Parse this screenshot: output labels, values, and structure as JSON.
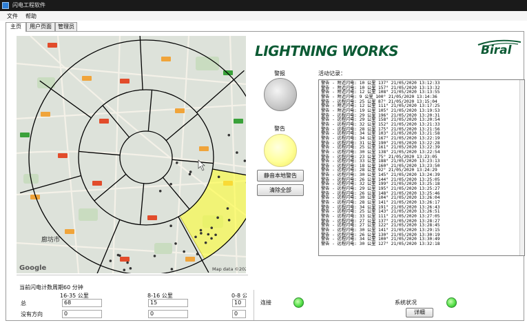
{
  "window": {
    "title": "闪电工程软件"
  },
  "menu": {
    "items": [
      "文件",
      "帮助"
    ]
  },
  "tabs": [
    {
      "label": "主页",
      "active": true
    },
    {
      "label": "用户页面",
      "active": false
    },
    {
      "label": "管理员",
      "active": false
    }
  ],
  "map": {
    "provider_logo": "Google",
    "attribution": "Map data ©2020",
    "city_label": "廊坊市",
    "highlight_color": "#ffff33",
    "ring_labels": [
      "16-35 公里",
      "8-16 公里",
      "0-8 公里"
    ]
  },
  "brand": {
    "name": "LIGHTNING WORKS",
    "logo": "Biral",
    "color": "#0c5a34"
  },
  "alarm": {
    "label": "警报",
    "state": "off"
  },
  "warning": {
    "label": "警告",
    "state": "on",
    "color": "#ffff66"
  },
  "buttons": {
    "mute_local": "静音本地警告",
    "clear_all": "清除全部",
    "details": "详细"
  },
  "activity": {
    "label": "活动记录：",
    "entries": [
      "警告 - 附近闪电: 10 公里 137° 21/05/2020 13:12:33",
      "警告 - 附近闪电: 10 公里 157° 21/05/2020 13:13:32",
      "警告 - 附近闪电: 12 公里 108° 21/05/2020 13:13:55",
      "警告 - 附近闪电: 9 公里 100° 21/05/2020 13:14:36",
      "警告 - 远程闪电: 25 公里 87° 21/05/2020 13:15:04",
      "警告 - 附近闪电: 12 公里 111° 21/05/2020 13:17:25",
      "警告 - 附近闪电: 19 公里 105° 21/05/2020 13:19:53",
      "警告 - 远程闪电: 29 公里 196° 21/05/2020 13:20:31",
      "警告 - 远程闪电: 29 公里 158° 21/05/2020 13:20:54",
      "警告 - 远程闪电: 32 公里 152° 21/05/2020 13:21:33",
      "警告 - 远程闪电: 28 公里 175° 21/05/2020 13:21:56",
      "警告 - 远程闪电: 34 公里 103° 21/05/2020 13:21:58",
      "警告 - 远程闪电: 34 公里 167° 21/05/2020 13:22:19",
      "警告 - 远程闪电: 31 公里 190° 21/05/2020 13:22:28",
      "警告 - 远程闪电: 25 公里 161° 21/05/2020 13:22:39",
      "警告 - 远程闪电: 30 公里 138° 21/05/2020 13:22:54",
      "警告 - 远程闪电: 23 公里 75° 21/05/2020 13:23:05",
      "警告 - 远程闪电: 33 公里 188° 21/05/2020 13:23:13",
      "警告 - 远程闪电: 18 公里 160° 21/05/2020 13:23:50",
      "警告 - 远程闪电: 28 公里 92° 21/05/2020 13:24:29",
      "警告 - 远程闪电: 30 公里 145° 21/05/2020 13:24:39",
      "警告 - 远程闪电: 26 公里 144° 21/05/2020 13:25:05",
      "警告 - 远程闪电: 32 公里 199° 21/05/2020 13:25:18",
      "警告 - 远程闪电: 29 公里 195° 21/05/2020 13:25:27",
      "警告 - 远程闪电: 26 公里 148° 21/05/2020 13:25:46",
      "警告 - 远程闪电: 30 公里 104° 21/05/2020 13:26:04",
      "警告 - 远程闪电: 28 公里 141° 21/05/2020 13:26:17",
      "警告 - 远程闪电: 34 公里 191° 21/05/2020 13:26:43",
      "警告 - 远程闪电: 25 公里 143° 21/05/2020 13:26:51",
      "警告 - 远程闪电: 33 公里 111° 21/05/2020 13:27:05",
      "警告 - 远程闪电: 27 公里 137° 21/05/2020 13:28:27",
      "警告 - 远程闪电: 27 公里 122° 21/05/2020 13:28:45",
      "警告 - 远程闪电: 30 公里 141° 21/05/2020 13:29:15",
      "警告 - 远程闪电: 26 公里 130° 21/05/2020 13:30:19",
      "警告 - 远程闪电: 34 公里 100° 21/05/2020 13:30:49",
      "警告 - 远程闪电: 30 公里 127° 21/05/2020 13:32:18"
    ]
  },
  "stats": {
    "period_label": "当前闪电计数周期60 分钟",
    "columns": [
      "16-35 公里",
      "8-16 公里",
      "0-8 公里"
    ],
    "rows": [
      {
        "label": "总",
        "values": [
          "68",
          "15",
          "10"
        ]
      },
      {
        "label": "没有方向",
        "values": [
          "0",
          "0",
          "0"
        ]
      }
    ]
  },
  "connection": {
    "label": "连接",
    "status": "green"
  },
  "system": {
    "label": "系统状况",
    "status": "green"
  }
}
